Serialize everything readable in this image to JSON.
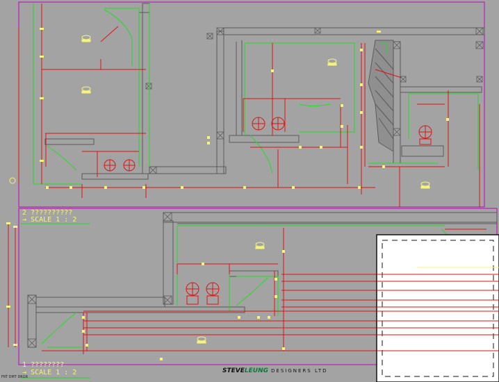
{
  "drawing": {
    "section_top": {
      "number": "2",
      "title": "??????????",
      "scale": "SCALE  1 : 2"
    },
    "section_bottom": {
      "number": "1",
      "title": "????????",
      "scale": "SCALE  1 : 2"
    },
    "company": {
      "name_part1": "STEVE",
      "name_part2": "LEUNG",
      "suffix": "DESIGNERS LTD"
    },
    "corner_note": "FRT DMT DRGR"
  },
  "colors": {
    "background": "#a3a3a3",
    "wall": "#5a5a5a",
    "wall_fill": "#8f8f8f",
    "dimension": "#e01010",
    "cabinet": "#22dd22",
    "label": "#f5f57a",
    "frame": "#c000c0",
    "titleblock": "#ffffff"
  }
}
